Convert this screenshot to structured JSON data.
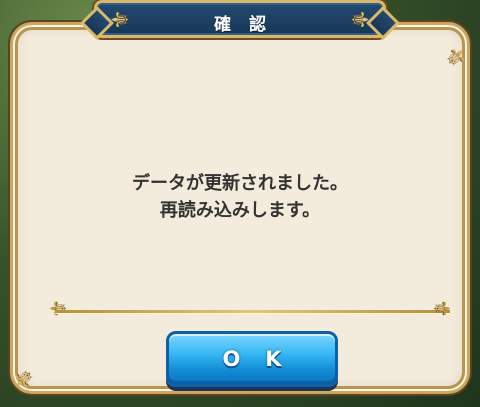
{
  "dialog": {
    "title": "確認",
    "message_lines": [
      "データが更新されました。",
      "再読み込みします。"
    ],
    "ok_label": "OK"
  },
  "icons": {
    "title_left": "fleur-icon",
    "title_right": "fleur-icon",
    "frame_corners": "fleur-icon",
    "divider_ends": "fleur-icon"
  },
  "colors": {
    "dialog_background": "#f3ebdc",
    "title_background": "#1f4468",
    "accent_gold": "#d8b262",
    "button_blue": "#1f9fe5",
    "text": "#333333"
  }
}
